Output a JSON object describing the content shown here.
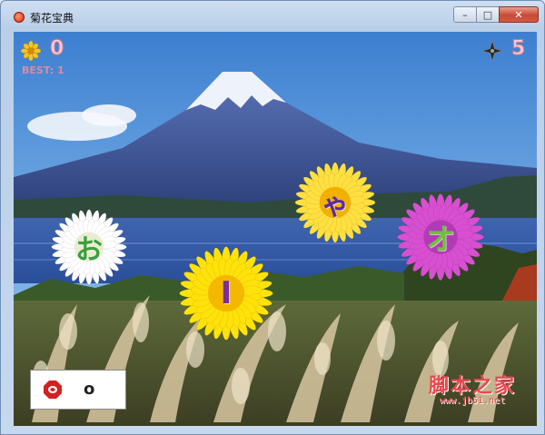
{
  "window": {
    "title": "菊花宝典",
    "controls": {
      "minimize": "–",
      "maximize": "□",
      "close": "✕"
    }
  },
  "hud": {
    "score": "0",
    "best_label": "BEST: 1",
    "lives": "5",
    "score_icon": "chrysanthemum-icon",
    "lives_icon": "shuriken-icon"
  },
  "flowers": [
    {
      "char": "お",
      "petal_color": "#ffffff",
      "center_color": "#e9ecd0",
      "glyph_color": "#3aa03a"
    },
    {
      "char": "I",
      "petal_color": "#ffe20a",
      "center_color": "#f4b800",
      "glyph_color": "#7a2ca0"
    },
    {
      "char": "ゃ",
      "petal_color": "#ffe040",
      "center_color": "#f2b000",
      "glyph_color": "#5a2aa8"
    },
    {
      "char": "オ",
      "petal_color": "#d84fd2",
      "center_color": "#b23bb5",
      "glyph_color": "#6ec13a"
    }
  ],
  "input": {
    "icon": "red-stop-icon",
    "typed": "o"
  },
  "watermark": {
    "main": "脚本之家",
    "sub": "www.jb51.net"
  },
  "colors": {
    "accent_pink": "#f4c8d6",
    "watermark_red": "#e8484e",
    "sky": "#6da7e2"
  }
}
